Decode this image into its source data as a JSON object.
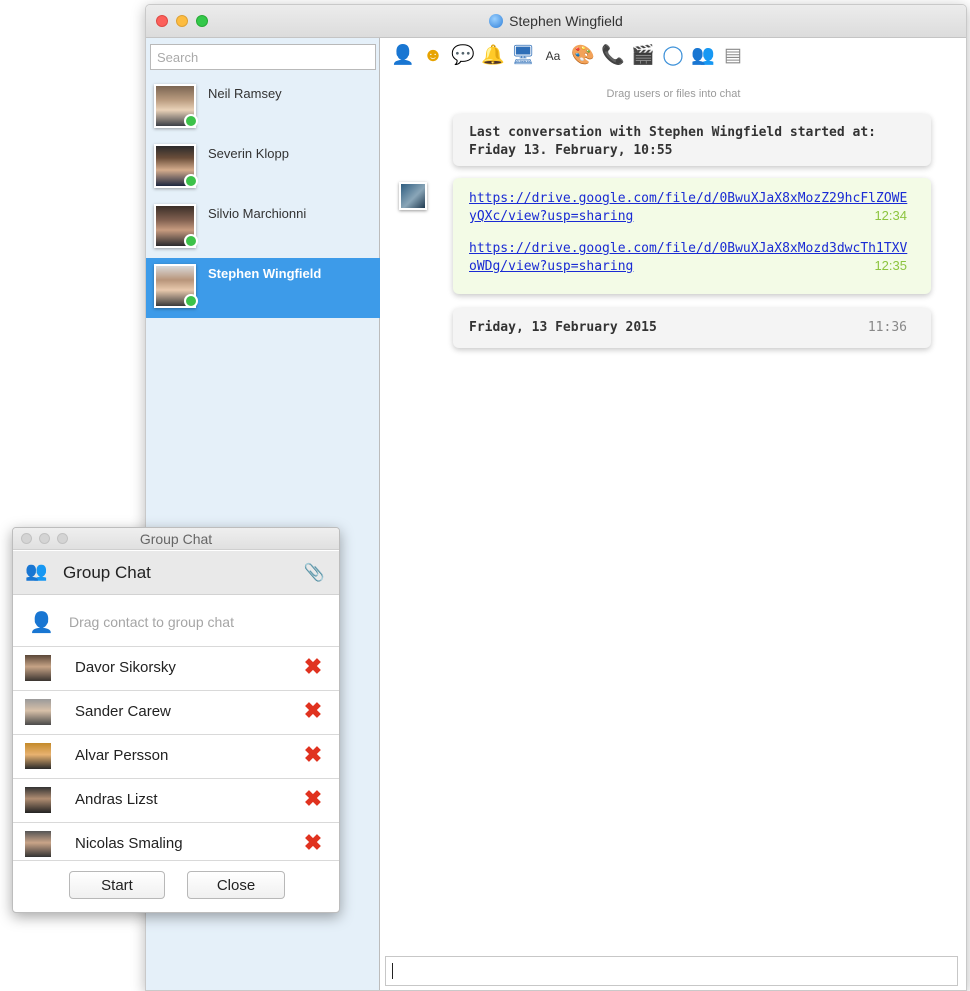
{
  "main_window": {
    "title": "Stephen Wingfield",
    "search": {
      "placeholder": "Search"
    },
    "contacts": [
      {
        "name": "Neil Ramsey",
        "selected": false
      },
      {
        "name": "Severin Klopp",
        "selected": false
      },
      {
        "name": "Silvio Marchionni",
        "selected": false
      },
      {
        "name": "Stephen Wingfield",
        "selected": true
      }
    ],
    "toolbar_icons": [
      "contact-card-icon",
      "emoji-icon",
      "speech-bubble-icon",
      "bell-icon",
      "screen-share-icon",
      "font-icon",
      "palette-icon",
      "phone-icon",
      "file-transfer-icon",
      "chat-icon",
      "user-icon",
      "calendar-icon"
    ],
    "drag_hint": "Drag users or files into chat",
    "info_bubble": {
      "line1": "Last conversation with Stephen Wingfield started at:",
      "line2": "Friday 13. February, 10:55"
    },
    "messages": [
      {
        "link": "https://drive.google.com/file/d/0BwuXJaX8xMozZ29hcFlZOWEyQXc/view?usp=sharing",
        "time": "12:34"
      },
      {
        "link": "https://drive.google.com/file/d/0BwuXJaX8xMozd3dwcTh1TXVoWDg/view?usp=sharing",
        "time": "12:35"
      }
    ],
    "date_bubble": {
      "date": "Friday, 13 February 2015",
      "time": "11:36"
    },
    "colors": {
      "selected_contact": "#3d9be9",
      "sidebar_bg": "#e5f0f9",
      "timestamp_green": "#8cc43f",
      "link": "#1a2bd4"
    }
  },
  "group_window": {
    "title": "Group Chat",
    "header": "Group Chat",
    "drag_hint": "Drag contact to group chat",
    "members": [
      "Davor Sikorsky",
      "Sander Carew",
      "Alvar Persson",
      "Andras Lizst",
      "Nicolas Smaling"
    ],
    "buttons": {
      "start": "Start",
      "close": "Close"
    },
    "colors": {
      "remove": "#e0321f"
    }
  }
}
